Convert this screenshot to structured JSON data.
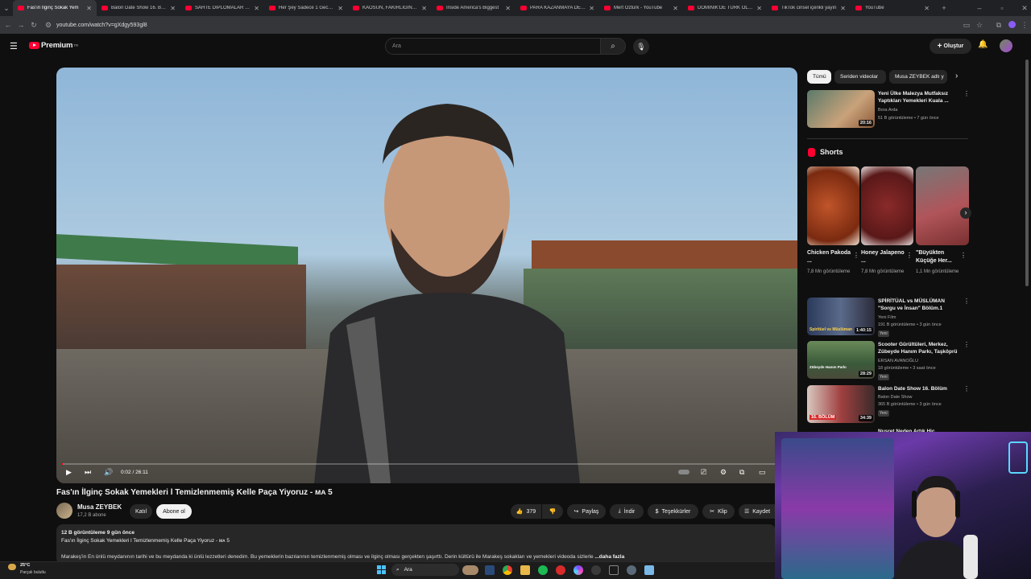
{
  "tabs": [
    {
      "title": "Fas'ın İlginç Sokak Yem",
      "active": true
    },
    {
      "title": "Balon Date Show 16. Bölüm",
      "active": false
    },
    {
      "title": "SAHTE DİPLOMALAR İFŞA",
      "active": false
    },
    {
      "title": "Her Şey Sadece 1 Gece İçin",
      "active": false
    },
    {
      "title": "KAOSUN, FAKİRLİĞİN VE",
      "active": false
    },
    {
      "title": "Inside America's Biggest",
      "active": false
    },
    {
      "title": "PARA KAZANMAYA DEĞER",
      "active": false
    },
    {
      "title": "Mert Öztürk - YouTube",
      "active": false
    },
    {
      "title": "DOMİNİK'DE TÜRK OLMAK",
      "active": false
    },
    {
      "title": "TikTok cinsel içerikli yayın",
      "active": false
    },
    {
      "title": "YouTube",
      "active": false
    }
  ],
  "browser": {
    "url": "youtube.com/watch?v=gXdgy593gl8"
  },
  "header": {
    "logo": "Premium",
    "logo_sup": "TR",
    "search_placeholder": "Ara",
    "create_label": "Oluştur"
  },
  "player": {
    "time": "0:02 / 26:11",
    "progress_fraction": 0.0013
  },
  "video": {
    "title": "Fas'ın İlginç Sokak Yemekleri l Temizlenmemiş Kelle Paça Yiyoruz - ᴍᴀ 5",
    "channel": "Musa ZEYBEK",
    "subscribers": "17,2 B abone",
    "join_label": "Katıl",
    "subscribe_label": "Abone ol",
    "likes": "379",
    "share_label": "Paylaş",
    "download_label": "İndir",
    "thanks_label": "Teşekkürler",
    "clip_label": "Klip",
    "save_label": "Kaydet"
  },
  "description": {
    "stats": "12 B görüntüleme  9 gün önce",
    "line1": "Fas'ın İlginç Sokak Yemekleri l Temizlenmemiş Kelle Paça Yiyoruz - ᴍᴀ 5",
    "line2": "Marakeş'in En ünlü meydanının tarihi ve bu meydanda ki ünlü lezzetleri denedim. Bu yemeklerin bazılarının temizlenmemiş olması ve ilginç olması gerçekten şaşırttı. Derin kültürü ile Marakeş sokakları ve yemekleri videoda sizlerle",
    "more": "...daha fazla"
  },
  "chips": [
    {
      "label": "Tümü",
      "active": true
    },
    {
      "label": "Seriden videolar",
      "active": false
    },
    {
      "label": "Musa ZEYBEK adlı y",
      "active": false
    }
  ],
  "shorts_header": "Shorts",
  "recommendations_top": [
    {
      "title": "Yeni Ülke Malezya Mutfaksız Yaptıkları Yemekleri Kuala ...",
      "channel": "Bora Arda",
      "meta": "51 B görüntüleme • 7 gün önce",
      "duration": "20:16"
    }
  ],
  "shorts": [
    {
      "title": "Chicken Pakoda ...",
      "views": "7,8 Mn görüntüleme"
    },
    {
      "title": "Honey Jalapeno ...",
      "views": "7,8 Mn görüntüleme"
    },
    {
      "title": "\"Büyükten Küçüğe Her...",
      "views": "1,1 Mn görüntüleme"
    }
  ],
  "recommendations": [
    {
      "title": "SPİRİTÜAL vs MÜSLÜMAN \"Sorgu ve İnsan\" Bölüm.1",
      "channel": "Yeni Film",
      "meta": "191 B görüntüleme • 3 gün önce",
      "badge": "Yeni",
      "duration": "1:40:15",
      "thumb_text": "Spiritüel vs Müslüman"
    },
    {
      "title": "Scooter Gürültüleri, Merkez, Zübeyde Hanım Parkı, Taşköprü",
      "channel": "ERSAN AVANOĞLU",
      "meta": "18 görüntüleme • 3 saat önce",
      "badge": "Yeni",
      "duration": "28:29",
      "thumb_text": "Zübeyde Hanım Parkı"
    },
    {
      "title": "Balon Date Show 16. Bölüm",
      "channel": "Balon Date Show",
      "meta": "365 B görüntüleme • 3 gün önce",
      "badge": "Yeni",
      "duration": "34:39",
      "thumb_text": "16. BÖLÜM"
    },
    {
      "title": "Nusret Neden Artık Hiç",
      "channel": "",
      "meta": "",
      "badge": "",
      "duration": "",
      "thumb_text": ""
    }
  ],
  "taskbar": {
    "temp": "25°C",
    "weather": "Parçalı bulutlu",
    "search": "Ara"
  }
}
